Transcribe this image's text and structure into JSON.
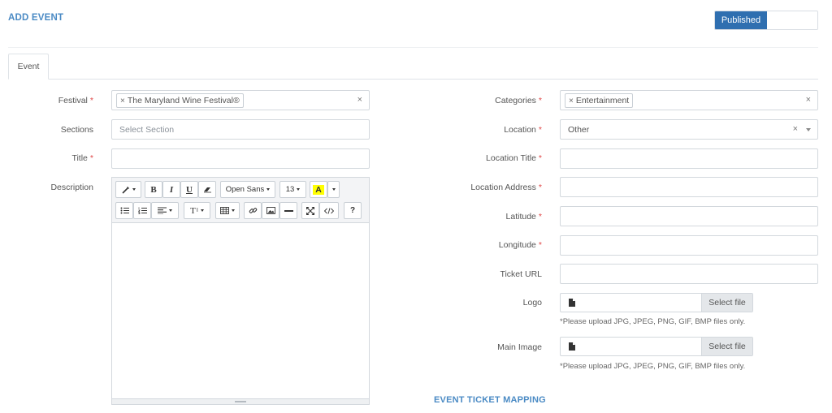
{
  "header": {
    "title": "ADD EVENT",
    "status_label": "Published"
  },
  "tabs": [
    {
      "label": "Event"
    }
  ],
  "left_form": {
    "festival": {
      "label": "Festival",
      "required": "*",
      "tag": "The Maryland Wine Festival®",
      "tag_remove": "×",
      "clear": "×"
    },
    "sections": {
      "label": "Sections",
      "placeholder": "Select Section"
    },
    "title": {
      "label": "Title",
      "required": "*",
      "value": ""
    },
    "description": {
      "label": "Description"
    }
  },
  "editor_toolbar": {
    "bold": "B",
    "italic": "I",
    "underline": "U",
    "font_name": "Open Sans",
    "font_size": "13",
    "color_letter": "A",
    "help": "?",
    "style_label": "T"
  },
  "right_form": {
    "categories": {
      "label": "Categories",
      "required": "*",
      "tag": "Entertainment",
      "tag_remove": "×",
      "clear": "×"
    },
    "location": {
      "label": "Location",
      "required": "*",
      "value": "Other",
      "clear": "×"
    },
    "location_title": {
      "label": "Location Title",
      "required": "*",
      "value": ""
    },
    "location_address": {
      "label": "Location Address",
      "required": "*",
      "value": ""
    },
    "latitude": {
      "label": "Latitude",
      "required": "*",
      "value": ""
    },
    "longitude": {
      "label": "Longitude",
      "required": "*",
      "value": ""
    },
    "ticket_url": {
      "label": "Ticket URL",
      "value": ""
    },
    "logo": {
      "label": "Logo",
      "button": "Select file",
      "help": "*Please upload JPG, JPEG, PNG, GIF, BMP files only."
    },
    "main_image": {
      "label": "Main Image",
      "button": "Select file",
      "help": "*Please upload JPG, JPEG, PNG, GIF, BMP files only."
    }
  },
  "sections": {
    "ticket_mapping_title": "EVENT TICKET MAPPING"
  },
  "colors": {
    "accent": "#4a8ac4",
    "published_bg": "#2f6fb0",
    "required": "#e04848",
    "highlight": "#ffff00"
  }
}
